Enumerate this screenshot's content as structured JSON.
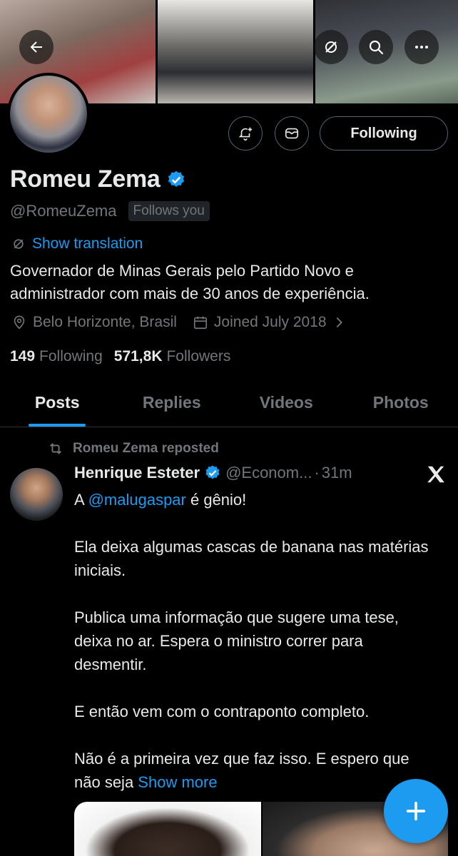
{
  "profile": {
    "name": "Romeu Zema",
    "handle": "@RomeuZema",
    "follows_you": "Follows you",
    "show_translation": "Show translation",
    "bio": "Governador de Minas Gerais pelo Partido Novo e administrador com mais de 30 anos de experiência.",
    "location": "Belo Horizonte, Brasil",
    "joined": "Joined July 2018",
    "following_count": "149",
    "following_label": "Following",
    "followers_count": "571,8K",
    "followers_label": "Followers"
  },
  "actions": {
    "following_button": "Following"
  },
  "tabs": [
    {
      "label": "Posts",
      "active": true
    },
    {
      "label": "Replies",
      "active": false
    },
    {
      "label": "Videos",
      "active": false
    },
    {
      "label": "Photos",
      "active": false
    }
  ],
  "post": {
    "repost_label": "Romeu Zema reposted",
    "author_name": "Henrique Esteter",
    "author_handle": "@Econom...",
    "separator": "·",
    "time": "31m",
    "line1_prefix": "A ",
    "mention": "@malugaspar",
    "line1_suffix": " é gênio!",
    "para2": "Ela deixa algumas cascas de banana nas matérias iniciais.",
    "para3": "Publica uma informação que sugere uma tese, deixa no ar. Espera o ministro correr para desmentir.",
    "para4": "E então vem com o contraponto completo.",
    "para5": "Não é a primeira vez que faz isso. E espero que não seja ",
    "show_more": "Show more"
  },
  "colors": {
    "accent": "#1d9bf0",
    "background": "#000000",
    "text_primary": "#e7e9ea",
    "text_secondary": "#71767b",
    "border": "#2f3336"
  },
  "icons": [
    "back-arrow-icon",
    "grok-icon",
    "search-icon",
    "more-icon",
    "add-notification-icon",
    "message-icon",
    "verified-badge-icon",
    "translate-icon",
    "location-icon",
    "calendar-icon",
    "chevron-right-icon",
    "repost-icon",
    "x-logo-icon",
    "plus-icon"
  ]
}
